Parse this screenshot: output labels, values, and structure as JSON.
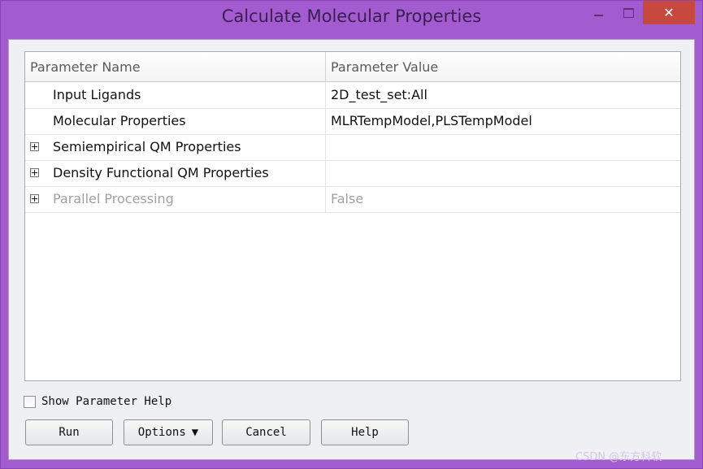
{
  "window": {
    "title": "Calculate Molecular Properties",
    "close_glyph": "✕",
    "accent_color": "#a35cd0",
    "close_color": "#c7483e"
  },
  "grid": {
    "columns": [
      "Parameter Name",
      "Parameter Value"
    ],
    "rows": [
      {
        "name": "Input Ligands",
        "value": "2D_test_set:All",
        "expandable": false,
        "disabled": false
      },
      {
        "name": "Molecular Properties",
        "value": "MLRTempModel,PLSTempModel",
        "expandable": false,
        "disabled": false
      },
      {
        "name": "Semiempirical QM Properties",
        "value": "",
        "expandable": true,
        "disabled": false
      },
      {
        "name": "Density Functional QM Properties",
        "value": "",
        "expandable": true,
        "disabled": false
      },
      {
        "name": "Parallel Processing",
        "value": "False",
        "expandable": true,
        "disabled": true
      }
    ]
  },
  "footer": {
    "show_help_label": "Show Parameter Help",
    "show_help_checked": false,
    "buttons": {
      "run": "Run",
      "options": "Options",
      "options_caret": "▼",
      "cancel": "Cancel",
      "help": "Help"
    }
  },
  "watermark": "CSDN @东方科软"
}
